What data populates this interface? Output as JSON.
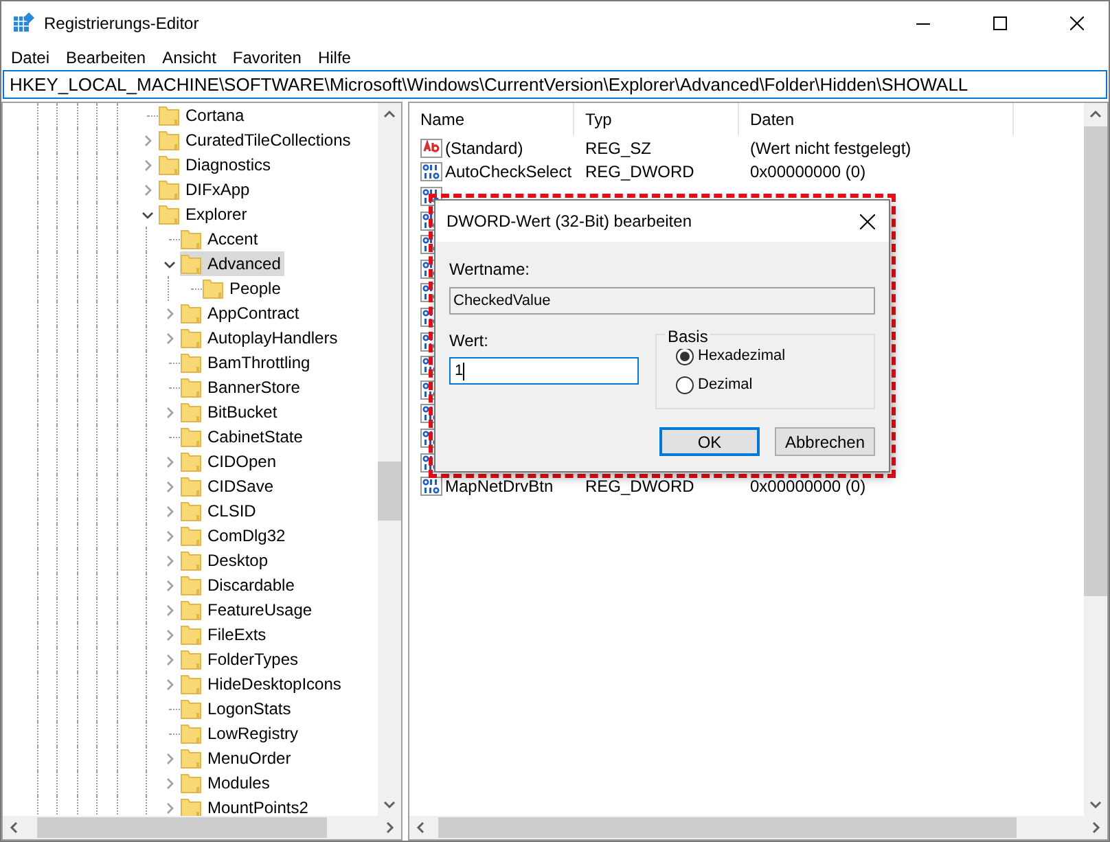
{
  "window": {
    "title": "Registrierungs-Editor"
  },
  "menu": [
    "Datei",
    "Bearbeiten",
    "Ansicht",
    "Favoriten",
    "Hilfe"
  ],
  "address": "HKEY_LOCAL_MACHINE\\SOFTWARE\\Microsoft\\Windows\\CurrentVersion\\Explorer\\Advanced\\Folder\\Hidden\\SHOWALL",
  "tree": [
    {
      "label": "Cortana",
      "kind": "leaf",
      "selected": false
    },
    {
      "label": "CuratedTileCollections",
      "kind": "branch",
      "expanded": false,
      "selected": false
    },
    {
      "label": "Diagnostics",
      "kind": "branch",
      "expanded": false,
      "selected": false
    },
    {
      "label": "DIFxApp",
      "kind": "branch",
      "expanded": false,
      "selected": false
    },
    {
      "label": "Explorer",
      "kind": "branch",
      "expanded": true,
      "selected": false,
      "children": [
        {
          "label": "Accent",
          "kind": "leaf",
          "selected": false
        },
        {
          "label": "Advanced",
          "kind": "branch",
          "expanded": true,
          "selected": true,
          "children": [
            {
              "label": "People",
              "kind": "leaf",
              "selected": false
            }
          ]
        },
        {
          "label": "AppContract",
          "kind": "branch",
          "expanded": false,
          "selected": false
        },
        {
          "label": "AutoplayHandlers",
          "kind": "branch",
          "expanded": false,
          "selected": false
        },
        {
          "label": "BamThrottling",
          "kind": "leaf",
          "selected": false
        },
        {
          "label": "BannerStore",
          "kind": "leaf",
          "selected": false
        },
        {
          "label": "BitBucket",
          "kind": "branch",
          "expanded": false,
          "selected": false
        },
        {
          "label": "CabinetState",
          "kind": "leaf",
          "selected": false
        },
        {
          "label": "CIDOpen",
          "kind": "branch",
          "expanded": false,
          "selected": false
        },
        {
          "label": "CIDSave",
          "kind": "branch",
          "expanded": false,
          "selected": false
        },
        {
          "label": "CLSID",
          "kind": "branch",
          "expanded": false,
          "selected": false
        },
        {
          "label": "ComDlg32",
          "kind": "branch",
          "expanded": false,
          "selected": false
        },
        {
          "label": "Desktop",
          "kind": "branch",
          "expanded": false,
          "selected": false
        },
        {
          "label": "Discardable",
          "kind": "branch",
          "expanded": false,
          "selected": false
        },
        {
          "label": "FeatureUsage",
          "kind": "branch",
          "expanded": false,
          "selected": false
        },
        {
          "label": "FileExts",
          "kind": "branch",
          "expanded": false,
          "selected": false
        },
        {
          "label": "FolderTypes",
          "kind": "branch",
          "expanded": false,
          "selected": false
        },
        {
          "label": "HideDesktopIcons",
          "kind": "branch",
          "expanded": false,
          "selected": false
        },
        {
          "label": "LogonStats",
          "kind": "leaf",
          "selected": false
        },
        {
          "label": "LowRegistry",
          "kind": "leaf",
          "selected": false
        },
        {
          "label": "MenuOrder",
          "kind": "branch",
          "expanded": false,
          "selected": false
        },
        {
          "label": "Modules",
          "kind": "branch",
          "expanded": false,
          "selected": false
        },
        {
          "label": "MountPoints2",
          "kind": "branch",
          "expanded": false,
          "selected": false
        }
      ]
    }
  ],
  "values": {
    "columns": [
      "Name",
      "Typ",
      "Daten"
    ],
    "rows": [
      {
        "kind": "string",
        "name": "(Standard)",
        "type": "REG_SZ",
        "data": "(Wert nicht festgelegt)"
      },
      {
        "kind": "dword",
        "name": "AutoCheckSelect",
        "type": "REG_DWORD",
        "data": "0x00000000 (0)"
      },
      {
        "kind": "dword"
      },
      {
        "kind": "dword"
      },
      {
        "kind": "dword"
      },
      {
        "kind": "dword"
      },
      {
        "kind": "dword"
      },
      {
        "kind": "dword"
      },
      {
        "kind": "dword"
      },
      {
        "kind": "dword"
      },
      {
        "kind": "dword"
      },
      {
        "kind": "dword"
      },
      {
        "kind": "dword"
      },
      {
        "kind": "dword"
      },
      {
        "kind": "dword",
        "name": "MapNetDrvBtn",
        "type": "REG_DWORD",
        "data": "0x00000000 (0)"
      }
    ]
  },
  "dialog": {
    "title": "DWORD-Wert (32-Bit) bearbeiten",
    "name_label": "Wertname:",
    "name_value": "CheckedValue",
    "value_label": "Wert:",
    "value": "1",
    "base_label": "Basis",
    "bases": [
      {
        "label": "Hexadezimal",
        "selected": true
      },
      {
        "label": "Dezimal",
        "selected": false
      }
    ],
    "buttons": [
      "OK",
      "Abbrechen"
    ]
  }
}
